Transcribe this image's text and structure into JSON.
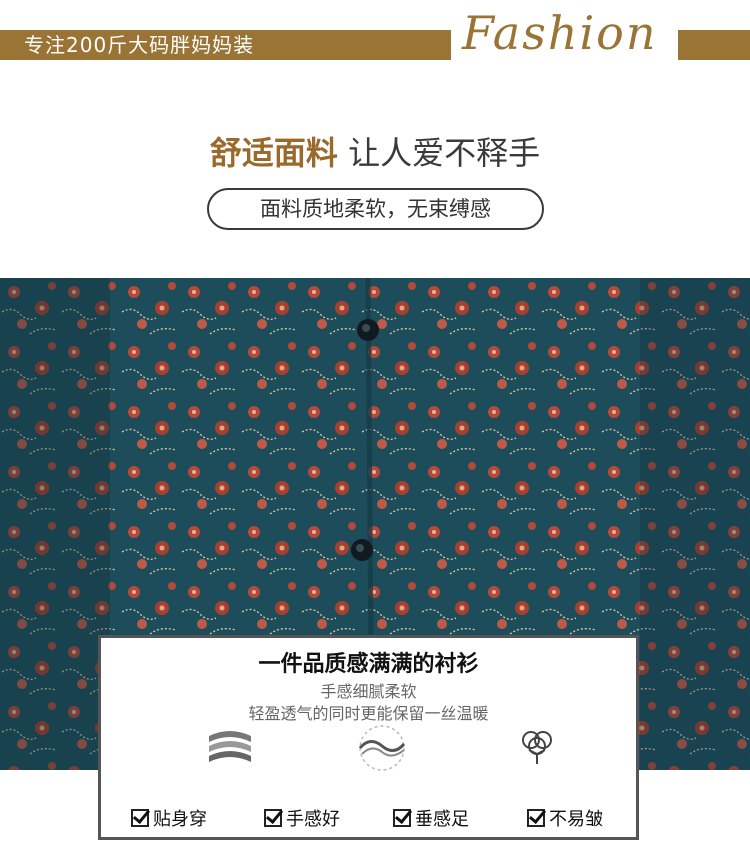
{
  "banner": {
    "slogan": "专注200斤大码胖妈妈装",
    "fashion_word": "Fashion"
  },
  "headline": {
    "accent": "舒适面料",
    "rest": "让人爱不释手"
  },
  "pill_text": "面料质地柔软，无束缚感",
  "card": {
    "title": "一件品质感满满的衬衫",
    "line1": "手感细腻柔软",
    "line2": "轻盈透气的同时更能保留一丝温暖",
    "icons": [
      "fabric-layers-icon",
      "fabric-wave-icon",
      "cotton-flower-icon"
    ],
    "features": [
      "贴身穿",
      "手感好",
      "垂感足",
      "不易皱"
    ]
  },
  "colors": {
    "brand_gold": "#9a7434",
    "fabric_teal": "#1c4a58",
    "flower_red": "#b5493a"
  }
}
